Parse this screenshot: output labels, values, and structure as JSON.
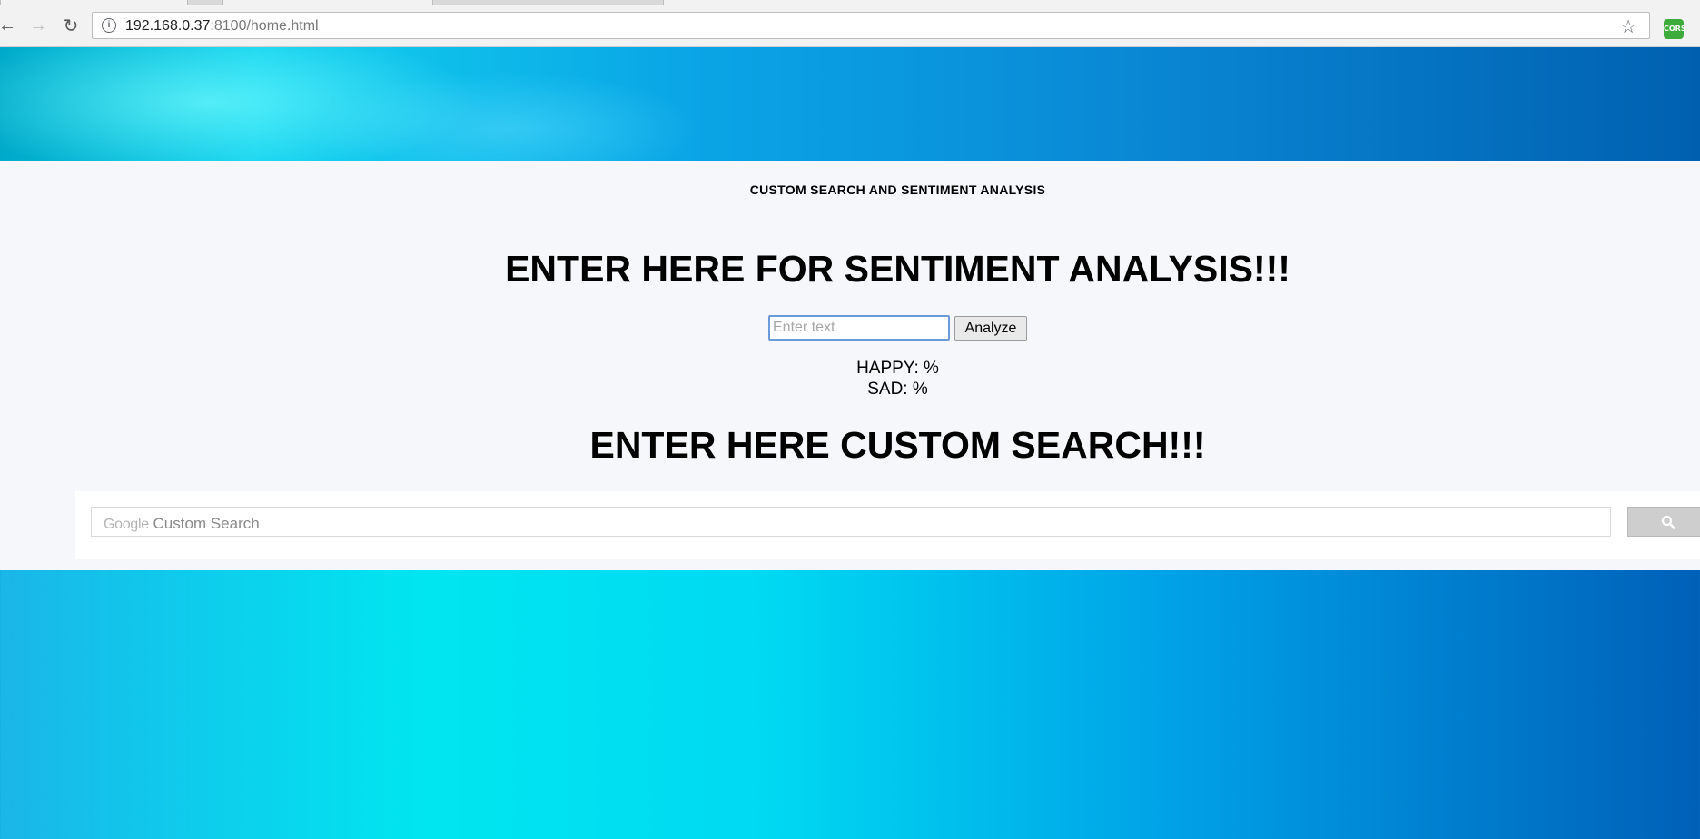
{
  "browser": {
    "url_host": "192.168.0.37",
    "url_rest": ":8100/home.html",
    "extension_label": "CORS"
  },
  "page": {
    "site_title": "CUSTOM SEARCH AND SENTIMENT ANALYSIS",
    "sentiment_heading": "ENTER HERE FOR SENTIMENT ANALYSIS!!!",
    "text_input": {
      "placeholder": "Enter text",
      "value": ""
    },
    "analyze_label": "Analyze",
    "happy_result": "HAPPY: %",
    "sad_result": "SAD: %",
    "search_heading": "ENTER HERE CUSTOM SEARCH!!!",
    "custom_search": {
      "brand": "Google",
      "placeholder": "Custom Search"
    }
  },
  "colors": {
    "hero_blue": "#0a8ad6",
    "hero_cyan": "#00e6f0",
    "content_bg": "#f5f7fb",
    "input_focus_border": "#6b9bd8"
  },
  "icons": [
    "back-arrow-icon",
    "forward-arrow-icon",
    "reload-icon",
    "info-icon",
    "star-icon",
    "search-icon"
  ]
}
